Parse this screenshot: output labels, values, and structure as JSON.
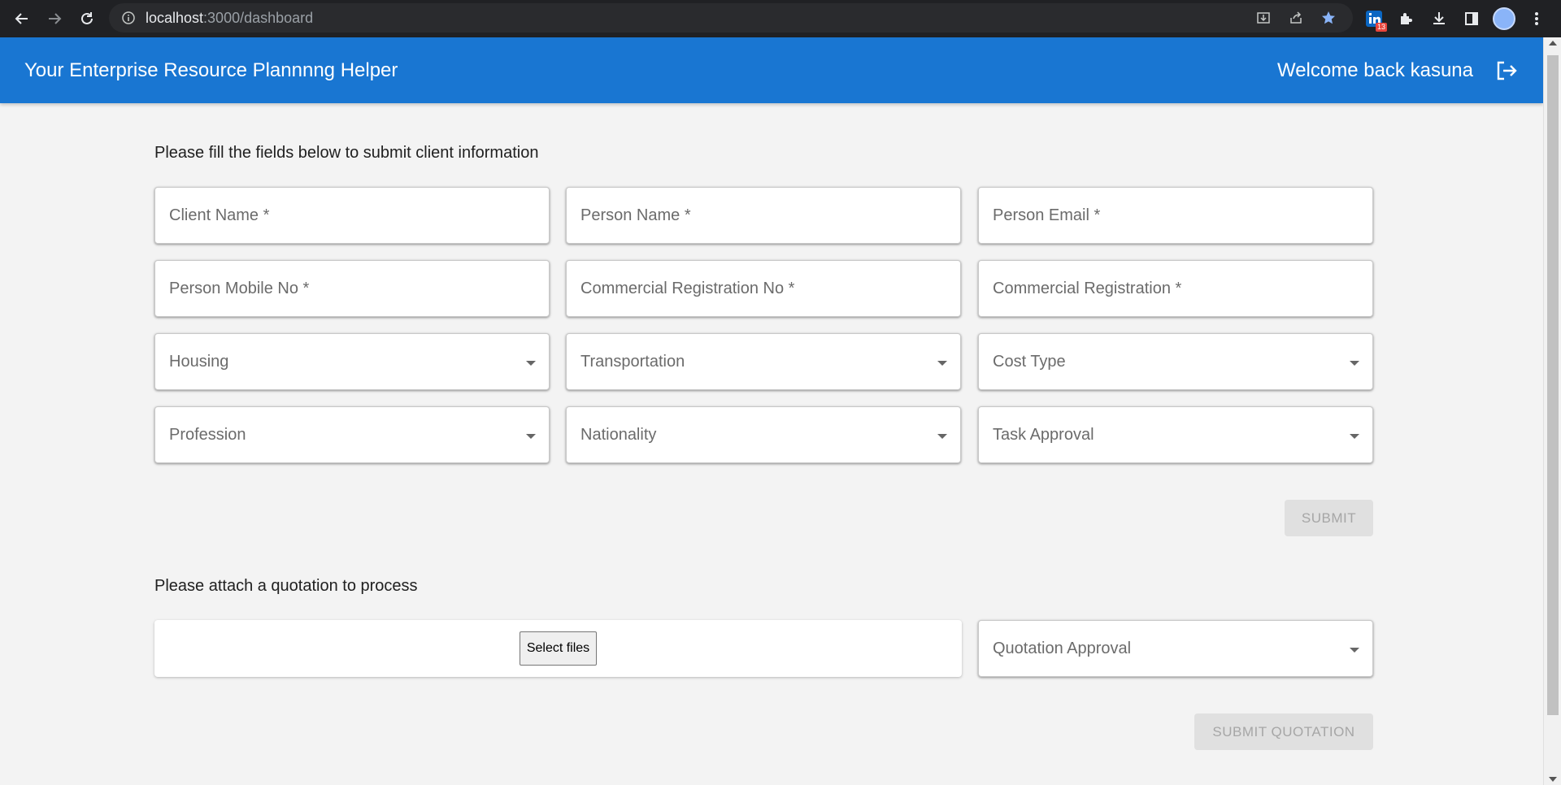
{
  "browser": {
    "url_host": "localhost",
    "url_path": ":3000/dashboard",
    "extension_badge": "13"
  },
  "appbar": {
    "title": "Your Enterprise Resource Plannnng Helper",
    "welcome": "Welcome back kasuna"
  },
  "client_form": {
    "heading": "Please fill the fields below to submit client information",
    "fields": [
      {
        "label": "Client Name *"
      },
      {
        "label": "Person Name *"
      },
      {
        "label": "Person Email *"
      },
      {
        "label": "Person Mobile No *"
      },
      {
        "label": "Commercial Registration No *"
      },
      {
        "label": "Commercial Registration *"
      },
      {
        "label": "Housing"
      },
      {
        "label": "Transportation"
      },
      {
        "label": "Cost Type"
      },
      {
        "label": "Profession"
      },
      {
        "label": "Nationality"
      },
      {
        "label": "Task Approval"
      }
    ],
    "submit_label": "SUBMIT"
  },
  "quotation": {
    "heading": "Please attach a quotation to process",
    "select_files_label": "Select files",
    "approval_label": "Quotation Approval",
    "submit_label": "SUBMIT QUOTATION"
  },
  "colors": {
    "appbar": "#1976d2",
    "background": "#f3f3f3",
    "chrome": "#202124"
  }
}
